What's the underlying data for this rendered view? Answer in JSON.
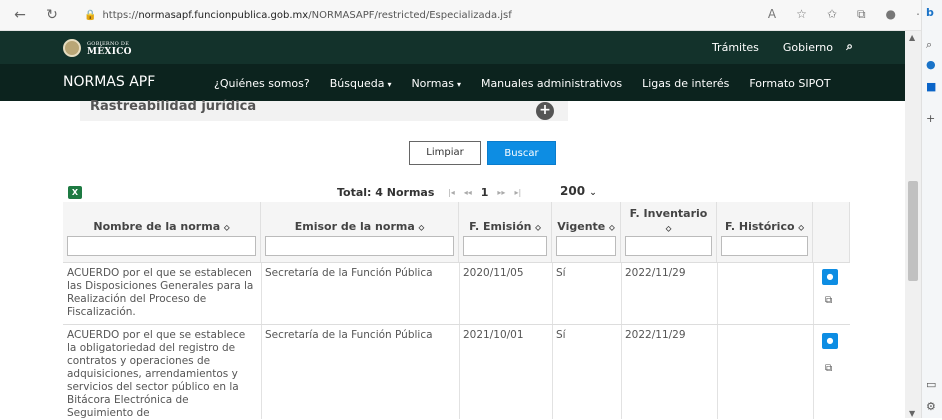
{
  "browser": {
    "url_prefix": "https://",
    "url_host": "normasapf.funcionpublica.gob.mx",
    "url_path": "/NORMASAPF/restricted/Especializada.jsf"
  },
  "gov_header": {
    "logo_small": "GOBIERNO DE",
    "logo_big": "MÉXICO",
    "links": [
      "Trámites",
      "Gobierno"
    ]
  },
  "nav": {
    "brand": "NORMAS APF",
    "items": [
      "¿Quiénes somos?",
      "Búsqueda",
      "Normas",
      "Manuales administrativos",
      "Ligas de interés",
      "Formato SIPOT"
    ]
  },
  "filter_panel": {
    "title": "Rastreabilidad jurídica"
  },
  "buttons": {
    "clear": "Limpiar",
    "search": "Buscar"
  },
  "results": {
    "total": "Total: 4 Normas",
    "page": "1",
    "page_size": "200"
  },
  "table": {
    "headers": [
      "Nombre de la norma",
      "Emisor de la norma",
      "F. Emisión",
      "Vigente",
      "F. Inventario",
      "F. Histórico"
    ],
    "rows": [
      {
        "nombre": "ACUERDO por el que se establecen las Disposiciones Generales para la Realización del Proceso de Fiscalización.",
        "emisor": "Secretaría de la Función Pública",
        "emision": "2020/11/05",
        "vigente": "Sí",
        "inventario": "2022/11/29",
        "historico": ""
      },
      {
        "nombre": "ACUERDO por el que se establece la obligatoriedad del registro de contratos y operaciones de adquisiciones, arrendamientos y servicios del sector público en la Bitácora Electrónica de Seguimiento de",
        "emisor": "Secretaría de la Función Pública",
        "emision": "2021/10/01",
        "vigente": "Sí",
        "inventario": "2022/11/29",
        "historico": ""
      }
    ]
  },
  "colors": {
    "gov_green": "#13322b",
    "nav_green": "#0c231e",
    "accent_blue": "#0d8de3"
  }
}
